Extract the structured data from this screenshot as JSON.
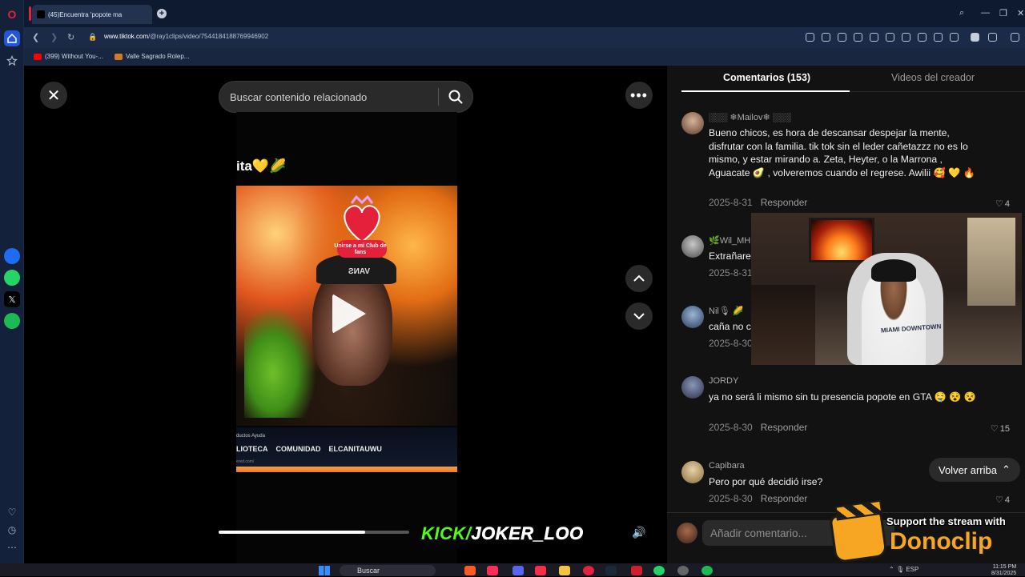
{
  "browser": {
    "tab_title": "(45)Encuentra 'popote ma",
    "url_host": "www.tiktok.com",
    "url_path": "/@ray1clips/video/7544184188769946902",
    "bookmarks": [
      "(399) Without You-...",
      "Valle Sagrado Rolep..."
    ]
  },
  "search": {
    "placeholder": "Buscar contenido relacionado"
  },
  "video": {
    "caption": "ita💛🌽",
    "fanclub_label": "Unirse a mi Club de fans",
    "cap_text": "VANS",
    "strip_top": "ductos   Ayuda",
    "strip_nav": [
      "LIOTECA",
      "COMUNIDAD",
      "ELCANITAUWU"
    ],
    "strip_url": "ered.com/",
    "progress": 0.77
  },
  "overlay": {
    "kick_prefix": "KICK/",
    "kick_channel": "JOKER_LOO"
  },
  "comments": {
    "tab_comments": "Comentarios (153)",
    "tab_creator": "Videos del creador",
    "reply_label": "Responder",
    "items": [
      {
        "user": "░░░ ❄Mailov❄ ░░░",
        "text": "Bueno chicos, es hora de descansar despejar la mente, disfrutar con la familia. tik tok sin el leder cañetazzz no es lo mismo, y estar mirando a. Zeta, Heyter, o la Marrona , Aguacate 🥑 , volveremos cuando el regrese. Awilii 🥰 💛 🔥",
        "date": "2025-8-31",
        "likes": "4"
      },
      {
        "user": "🌿Wil_MH",
        "text": "Extrañare",
        "date": "2025-8-31",
        "likes": ""
      },
      {
        "user": "Nil🎙 🌽",
        "text": "caña no c",
        "date": "2025-8-30",
        "likes": ""
      },
      {
        "user": "JORDY",
        "text": "ya no será li mismo sin tu presencia popote en GTA 🤤 😵 😵",
        "date": "2025-8-30",
        "likes": "15"
      },
      {
        "user": "Capibara",
        "text": "Pero por qué decidió irse?",
        "date": "2025-8-30",
        "likes": "4"
      }
    ],
    "scroll_top_label": "Volver arriba",
    "input_placeholder": "Añadir comentario..."
  },
  "webcam": {
    "shirt_text": "MIAMI DOWNTOWN"
  },
  "donoclip": {
    "support_text": "Support the stream with",
    "brand": "Donoclip"
  },
  "taskbar": {
    "search_label": "Buscar",
    "tray_lang": "ESP",
    "time": "11:15 PM",
    "date": "8/31/2025"
  },
  "colors": {
    "kick_green": "#53fc18",
    "donoclip_orange": "#f6a623",
    "opera_red": "#e2233d"
  }
}
